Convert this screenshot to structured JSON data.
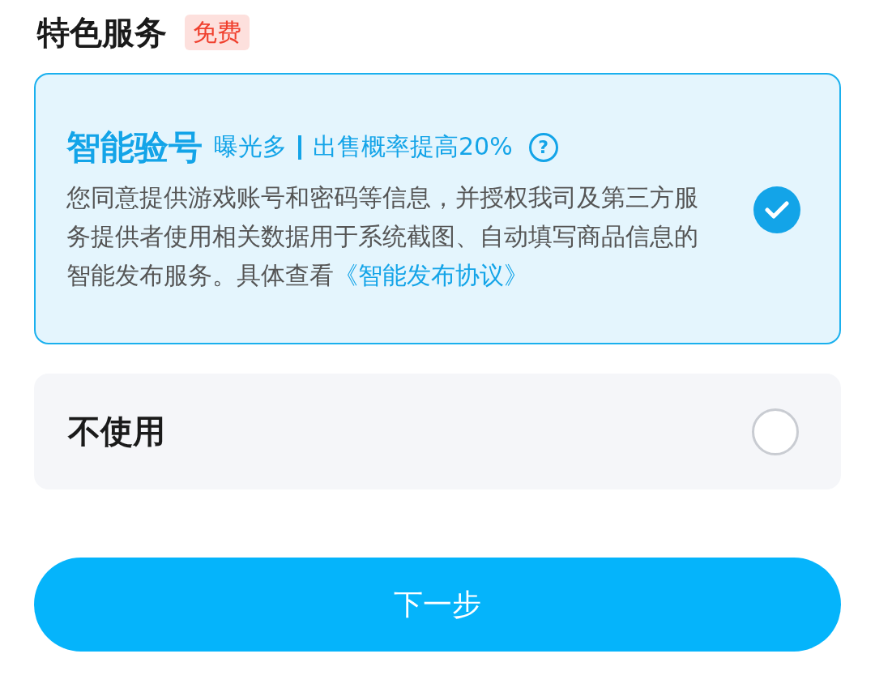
{
  "section": {
    "title": "特色服务",
    "badge": "免费"
  },
  "options": [
    {
      "kind": "detailed",
      "title": "智能验号",
      "tags": [
        "曝光多",
        "出售概率提高20%"
      ],
      "help": "?",
      "description": "您同意提供游戏账号和密码等信息，并授权我司及第三方服务提供者使用相关数据用于系统截图、自动填写商品信息的智能发布服务。具体查看",
      "link": "《智能发布协议》",
      "selected": true
    },
    {
      "kind": "simple",
      "title": "不使用",
      "selected": false
    }
  ],
  "next_button": "下一步"
}
